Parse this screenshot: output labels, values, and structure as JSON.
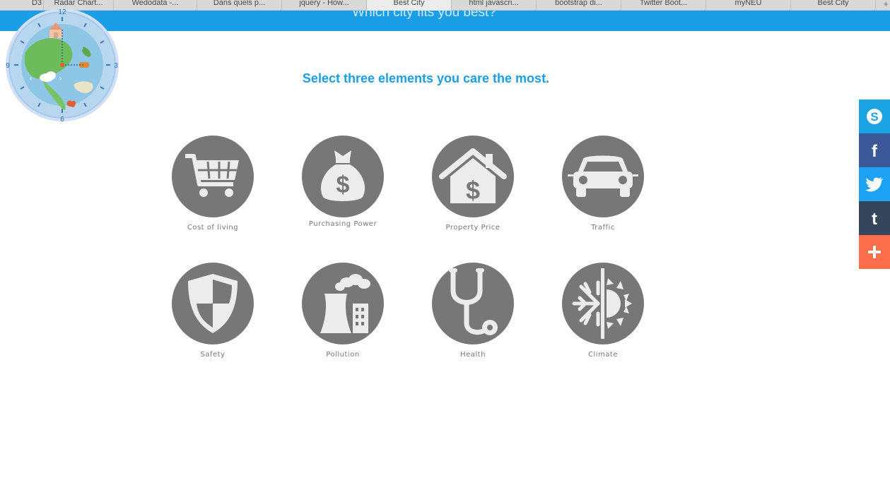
{
  "browser": {
    "tabs": [
      {
        "label": "D3",
        "active": false
      },
      {
        "label": "Radar Chart...",
        "active": false
      },
      {
        "label": "Wedodata -...",
        "active": false
      },
      {
        "label": "Dans quels p...",
        "active": false
      },
      {
        "label": "jquery - How...",
        "active": false
      },
      {
        "label": "Best City",
        "active": true
      },
      {
        "label": "html javascri...",
        "active": false
      },
      {
        "label": "bootstrap di...",
        "active": false
      },
      {
        "label": "Twitter Boot...",
        "active": false
      },
      {
        "label": "myNEU",
        "active": false
      },
      {
        "label": "Best City",
        "active": false
      }
    ],
    "new_tab": "+"
  },
  "header": {
    "title": "Which city fits you best?"
  },
  "clock": {
    "n12": "12",
    "n3": "3",
    "n6": "6",
    "n9": "9"
  },
  "prompt": "Select three elements you care the most.",
  "options": [
    {
      "label": "Cost of living",
      "icon": "shopping-cart-icon"
    },
    {
      "label": "Purchasing Power",
      "icon": "money-bag-icon"
    },
    {
      "label": "Property Price",
      "icon": "house-dollar-icon"
    },
    {
      "label": "Traffic",
      "icon": "car-icon"
    },
    {
      "label": "Safety",
      "icon": "shield-icon"
    },
    {
      "label": "Pollution",
      "icon": "factory-icon"
    },
    {
      "label": "Health",
      "icon": "stethoscope-icon"
    },
    {
      "label": "Climate",
      "icon": "snow-sun-icon"
    }
  ],
  "share": {
    "buttons": [
      {
        "name": "skype",
        "color": "#1aa2e2"
      },
      {
        "name": "facebook",
        "color": "#3b5998"
      },
      {
        "name": "twitter",
        "color": "#1da1f2"
      },
      {
        "name": "tumblr",
        "color": "#35465c"
      },
      {
        "name": "more",
        "color": "#fc6d4c"
      }
    ]
  },
  "colors": {
    "accent": "#1a9ee6",
    "icon_bg": "#777777",
    "icon_fg": "#ececec"
  }
}
